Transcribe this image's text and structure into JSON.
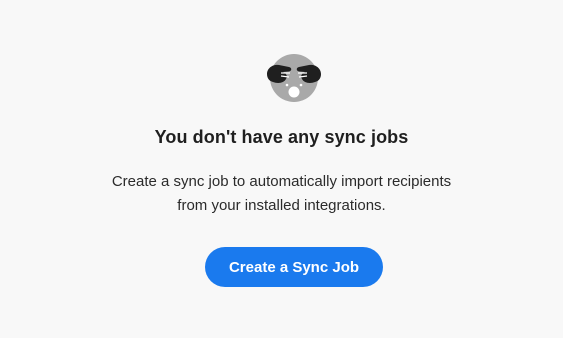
{
  "empty_state": {
    "icon": "see-no-evil-monkey-icon",
    "heading": "You don't have any sync jobs",
    "description_line1": "Create a sync job to automatically import recipients",
    "description_line2": "from your installed integrations.",
    "button_label": "Create a Sync Job"
  },
  "colors": {
    "background": "#f8f8f8",
    "button": "#1a7aee",
    "illustration_face": "#a9a9a9",
    "illustration_hands": "#1f1f1f"
  }
}
